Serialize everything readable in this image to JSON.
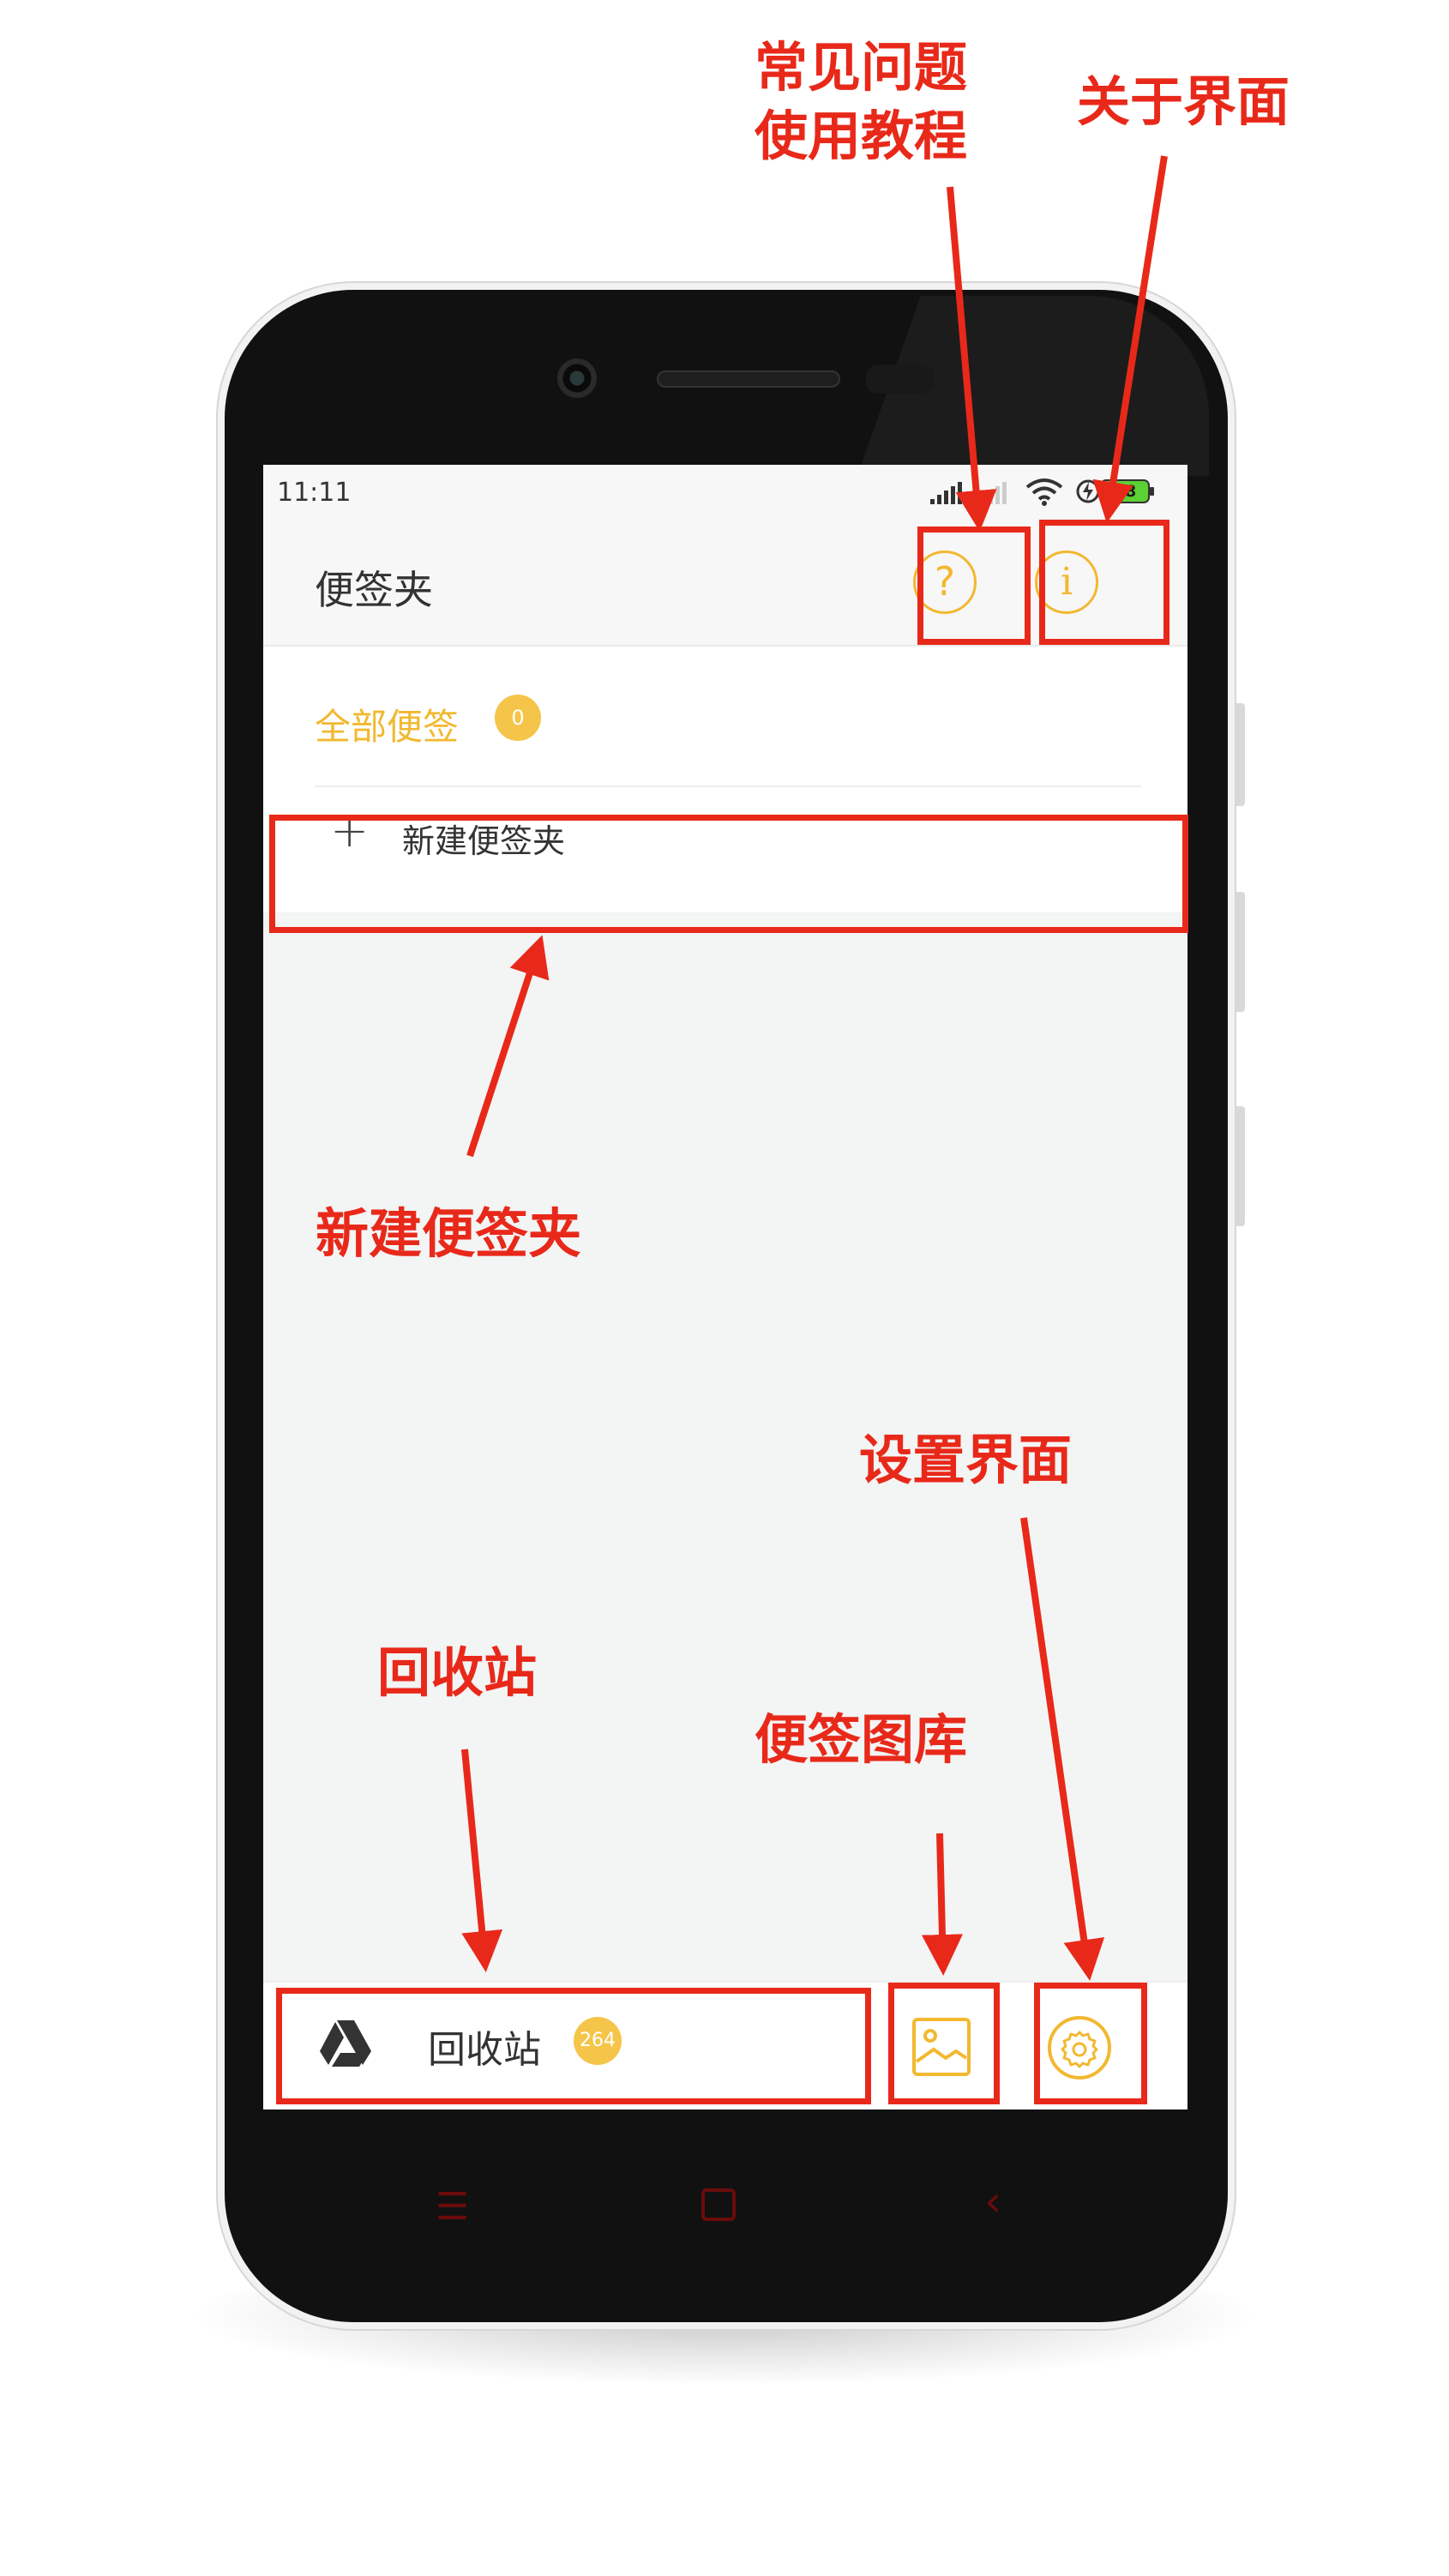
{
  "status_bar": {
    "time": "11:11",
    "battery": "98"
  },
  "app_bar": {
    "title": "便签夹",
    "help_icon": "question-circle-icon",
    "about_icon": "info-circle-icon"
  },
  "folders": {
    "all_notes_label": "全部便签",
    "all_notes_count": "0",
    "new_folder_label": "新建便签夹"
  },
  "bottom_bar": {
    "trash_label": "回收站",
    "trash_count": "264",
    "gallery_icon": "image-icon",
    "settings_icon": "gear-icon"
  },
  "annotations": {
    "faq_line1": "常见问题",
    "faq_line2": "使用教程",
    "about": "关于界面",
    "new_folder": "新建便签夹",
    "settings": "设置界面",
    "trash": "回收站",
    "gallery": "便签图库"
  },
  "colors": {
    "accent": "#f2b830",
    "annotation": "#e8291a",
    "nav_keys": "#6b0b0b"
  }
}
